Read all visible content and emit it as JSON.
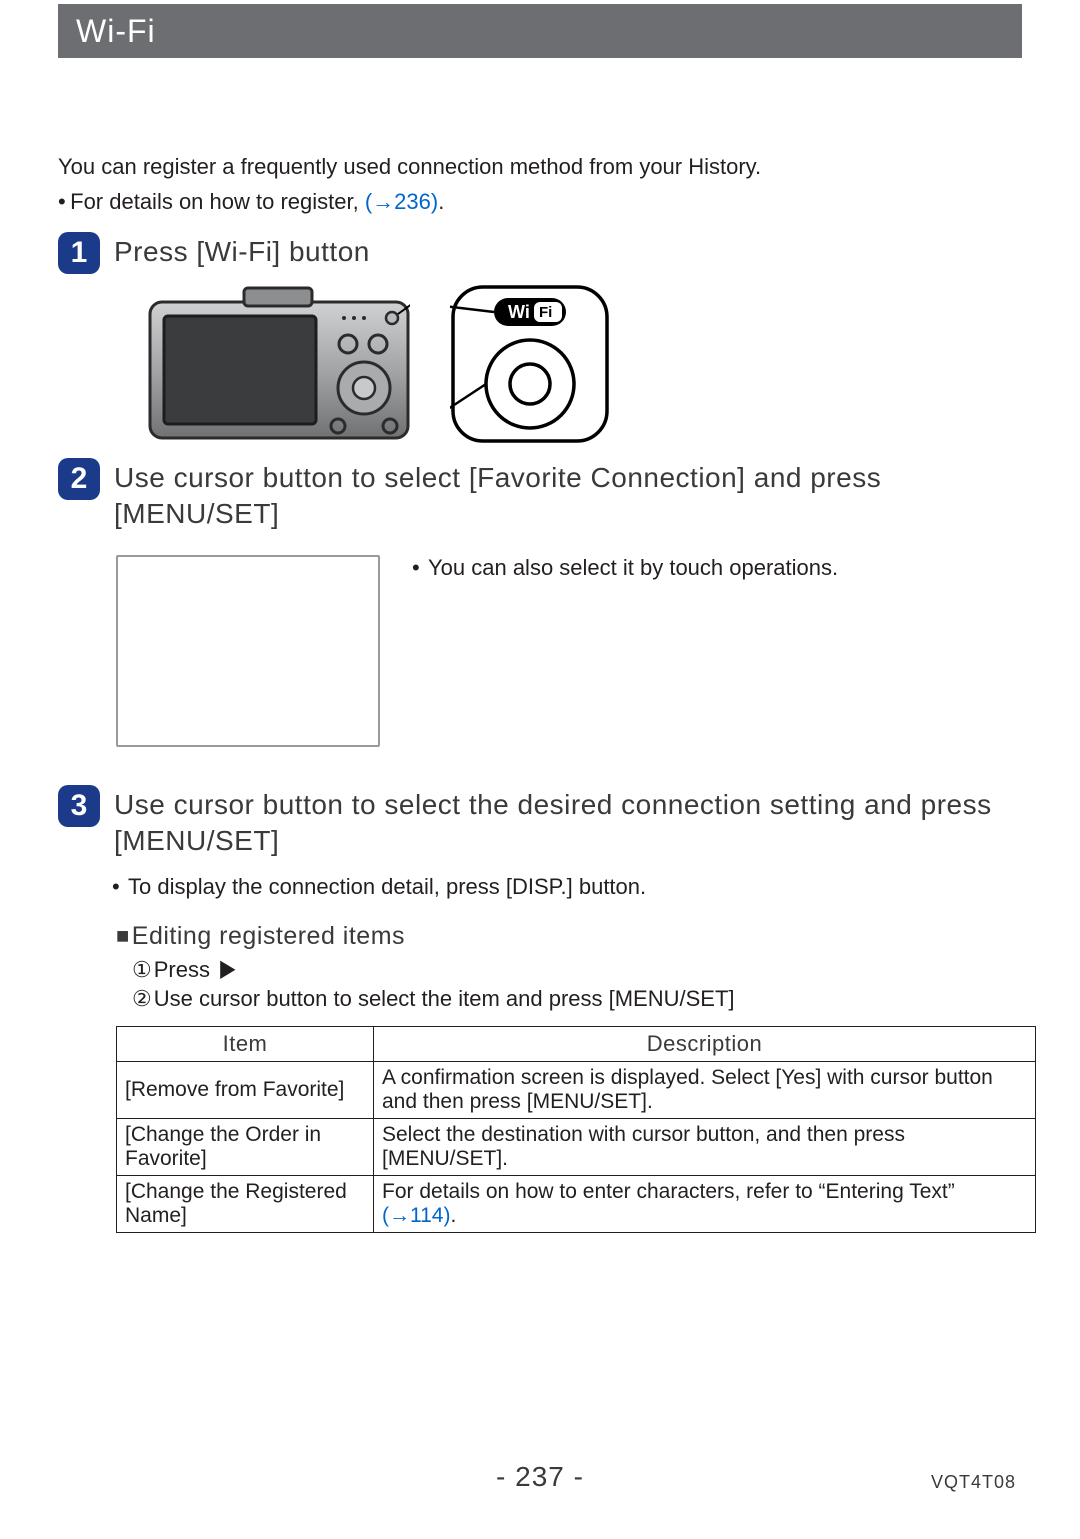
{
  "header": {
    "title": "Wi-Fi"
  },
  "intro": {
    "line1": "You can register a frequently used connection method from your History.",
    "bullet_prefix": "For details on how to register, ",
    "bullet_link": "(→236)",
    "bullet_suffix": "."
  },
  "steps": {
    "s1": {
      "num": "1",
      "title": "Press [Wi-Fi] button"
    },
    "s2": {
      "num": "2",
      "title": "Use cursor button to select [Favorite Connection] and press [MENU/SET]",
      "note": "You can also select it by touch operations."
    },
    "s3": {
      "num": "3",
      "title": "Use cursor button to select the desired connection setting and press [MENU/SET]",
      "note": "To display the connection detail, press [DISP.] button."
    }
  },
  "editing": {
    "heading": "Editing registered items",
    "sub1_label": "Press",
    "sub2": "Use cursor button to select the item and press [MENU/SET]"
  },
  "table": {
    "head_item": "Item",
    "head_desc": "Description",
    "rows": [
      {
        "item": "[Remove from Favorite]",
        "desc": "A confirmation screen is displayed. Select [Yes] with cursor button and then press [MENU/SET]."
      },
      {
        "item": "[Change the Order in Favorite]",
        "desc": "Select the destination with cursor button, and then press [MENU/SET]."
      },
      {
        "item": "[Change the Registered Name]",
        "desc_prefix": "For details on how to enter characters, refer to “Entering Text” ",
        "desc_link": "(→114)",
        "desc_suffix": "."
      }
    ]
  },
  "footer": {
    "page": "- 237 -",
    "doc_code": "VQT4T08"
  },
  "icons": {
    "wifi_badge": "WiFi"
  }
}
